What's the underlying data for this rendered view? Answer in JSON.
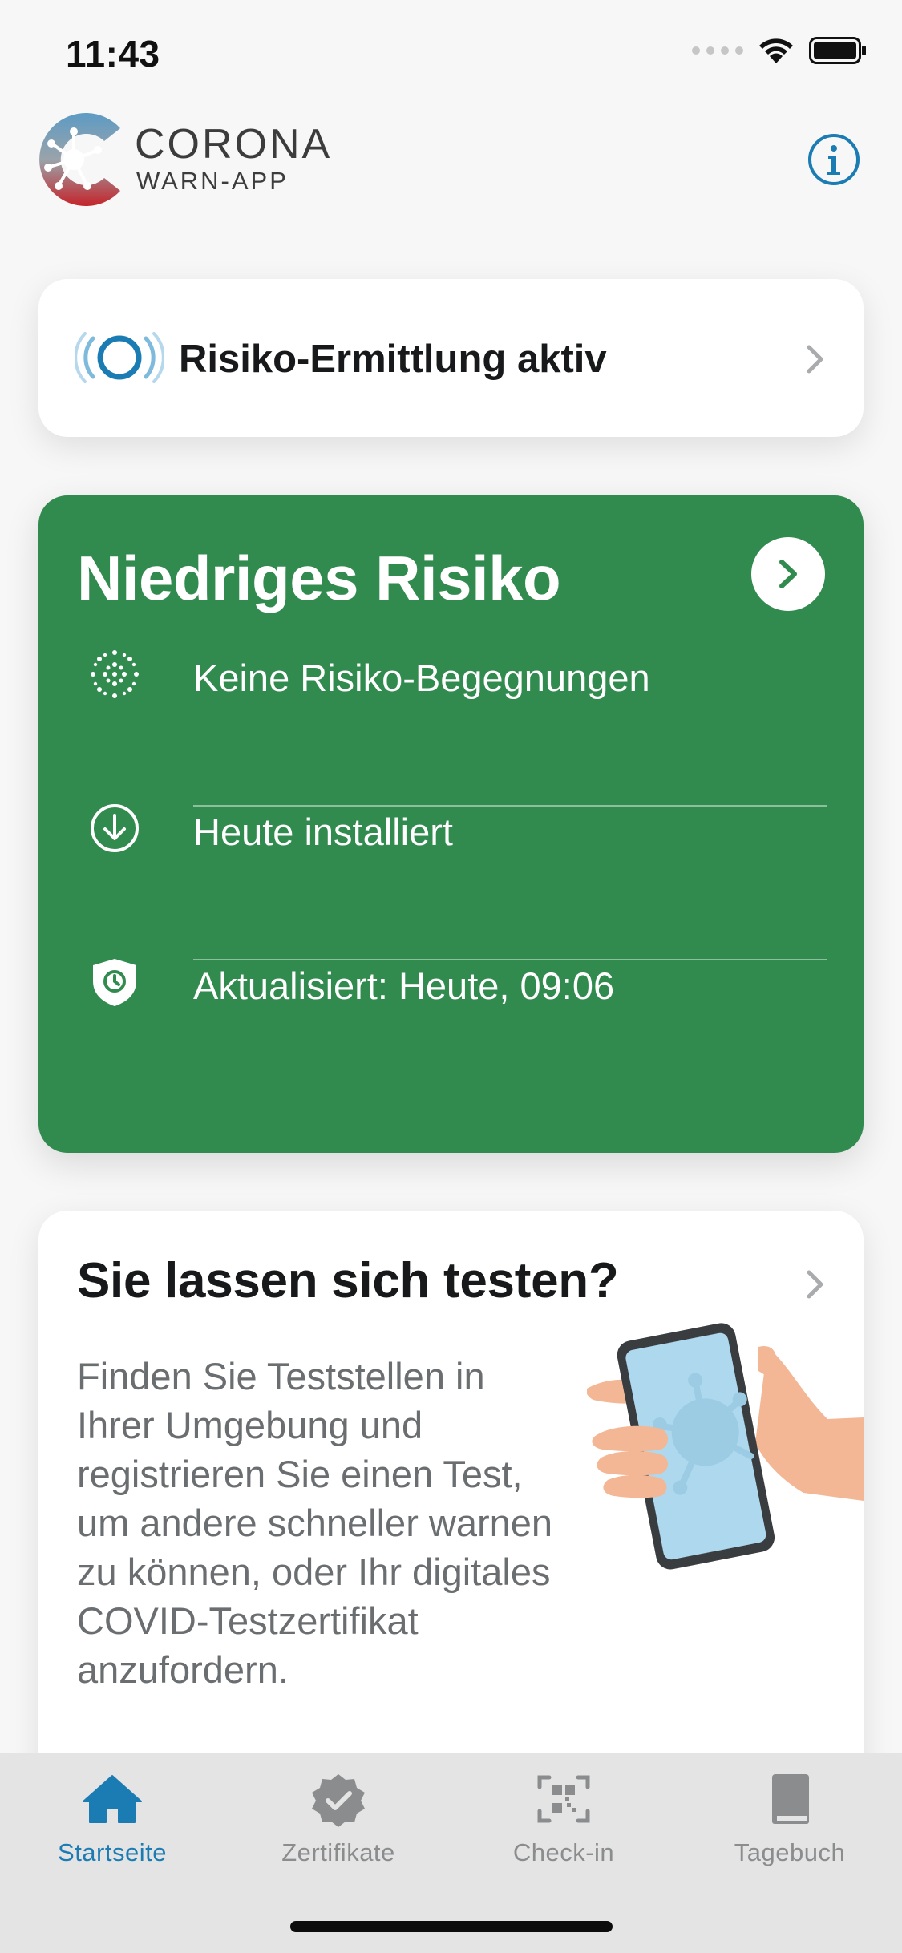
{
  "status_bar": {
    "time": "11:43"
  },
  "header": {
    "app_name": "CORONA",
    "app_subtitle": "WARN-APP",
    "info_icon": "info-circle-icon"
  },
  "tracing": {
    "label": "Risiko-Ermittlung aktiv"
  },
  "risk": {
    "title": "Niedriges Risiko",
    "color": "#318a4e",
    "rows": [
      {
        "icon": "virus-dots-icon",
        "text": "Keine Risiko-Begegnungen"
      },
      {
        "icon": "download-circle-icon",
        "text": "Heute installiert"
      },
      {
        "icon": "shield-clock-icon",
        "text": "Aktualisiert: Heute, 09:06"
      }
    ]
  },
  "test": {
    "title": "Sie lassen sich testen?",
    "body": "Finden Sie Teststellen in Ihrer Umgebung und registrieren Sie einen Test, um andere schneller warnen zu können, oder Ihr digitales COVID-Testzertifikat anzufordern."
  },
  "tabs": [
    {
      "label": "Startseite",
      "icon": "home-icon",
      "active": true
    },
    {
      "label": "Zertifikate",
      "icon": "certificate-badge-icon",
      "active": false
    },
    {
      "label": "Check-in",
      "icon": "qr-scan-icon",
      "active": false
    },
    {
      "label": "Tagebuch",
      "icon": "book-icon",
      "active": false
    }
  ],
  "colors": {
    "accent": "#1b7cb4",
    "risk_green": "#318a4e",
    "tab_inactive": "#8a8c8e"
  }
}
